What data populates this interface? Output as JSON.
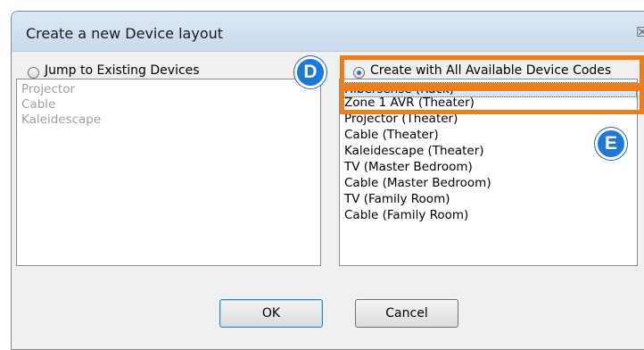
{
  "dialog": {
    "title": "Create a new Device layout",
    "close_glyph": "☒"
  },
  "left_option": {
    "label": "Jump to Existing Devices",
    "selected": false,
    "items": [
      "Projector",
      "Cable",
      "Kaleidescape"
    ]
  },
  "right_option": {
    "label": "Create with All Available Device Codes",
    "selected": true,
    "items": [
      "Hibersense (Rack)",
      "Zone 1 AVR (Theater)",
      "Projector (Theater)",
      "Cable (Theater)",
      "Kaleidescape (Theater)",
      "TV (Master Bedroom)",
      "Cable (Master Bedroom)",
      "TV (Family Room)",
      "Cable (Family Room)"
    ],
    "selected_item": "Hibersense (Rack)"
  },
  "annotations": {
    "d_label": "D",
    "e_label": "E",
    "accent_color": "#ef7d1c",
    "badge_color": "#1d78d8"
  },
  "buttons": {
    "ok_label": "OK",
    "cancel_label": "Cancel"
  }
}
